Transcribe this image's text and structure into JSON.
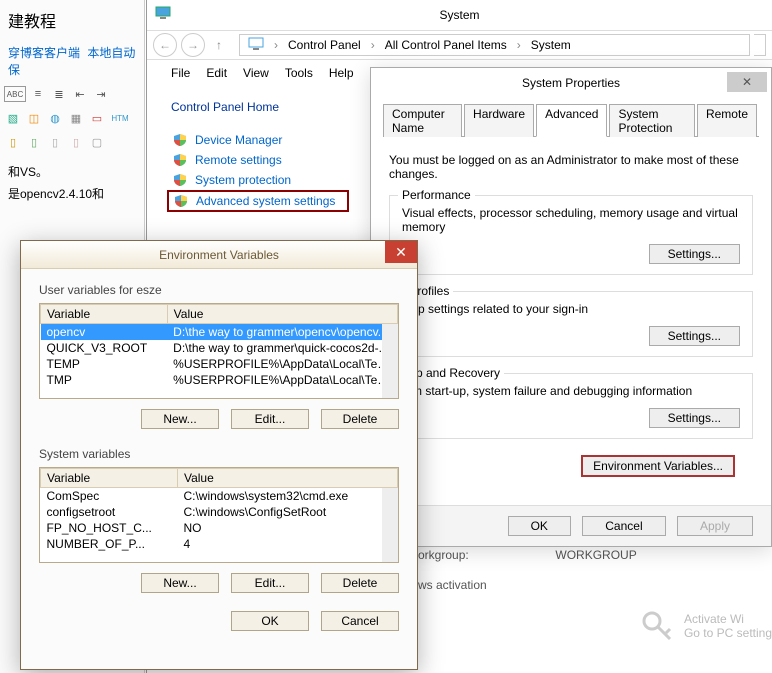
{
  "bg": {
    "title": "建教程",
    "links": [
      "穿博客客户端",
      "本地自动保"
    ],
    "text1": "和VS。",
    "text2": "是opencv2.4.10和"
  },
  "sys": {
    "title": "System",
    "crumb": [
      "Control Panel",
      "All Control Panel Items",
      "System"
    ],
    "menu": [
      "File",
      "Edit",
      "View",
      "Tools",
      "Help"
    ],
    "side_heading": "Control Panel Home",
    "links": [
      {
        "label": "Device Manager"
      },
      {
        "label": "Remote settings"
      },
      {
        "label": "System protection"
      },
      {
        "label": "Advanced system settings",
        "hl": true
      }
    ]
  },
  "prop": {
    "title": "System Properties",
    "tabs": [
      "Computer Name",
      "Hardware",
      "Advanced",
      "System Protection",
      "Remote"
    ],
    "note": "You must be logged on as an Administrator to make most of these changes.",
    "groups": [
      {
        "lbl": "Performance",
        "desc": "Visual effects, processor scheduling, memory usage and virtual memory",
        "btn": "Settings..."
      },
      {
        "lbl": "r Profiles",
        "desc": "ktop settings related to your sign-in",
        "btn": "Settings..."
      },
      {
        "lbl": "t-up and Recovery",
        "desc": "tem start-up, system failure and debugging information",
        "btn": "Settings..."
      }
    ],
    "env_btn": "Environment Variables...",
    "ok": "OK",
    "cancel": "Cancel",
    "apply": "Apply"
  },
  "frag": {
    "workgroup_lbl": "orkgroup:",
    "workgroup_val": "WORKGROUP",
    "activation": "ws activation",
    "activate": "Activate Wi",
    "activate_sub": "Go to PC setting"
  },
  "env": {
    "title": "Environment Variables",
    "user_lbl": "User variables for esze",
    "sys_lbl": "System variables",
    "col1": "Variable",
    "col2": "Value",
    "user_vars": [
      {
        "n": "opencv",
        "v": "D:\\the way to grammer\\opencv\\opencv...",
        "sel": true
      },
      {
        "n": "QUICK_V3_ROOT",
        "v": "D:\\the way to grammer\\quick-cocos2d-..."
      },
      {
        "n": "TEMP",
        "v": "%USERPROFILE%\\AppData\\Local\\Temp"
      },
      {
        "n": "TMP",
        "v": "%USERPROFILE%\\AppData\\Local\\Temp"
      }
    ],
    "sys_vars": [
      {
        "n": "ComSpec",
        "v": "C:\\windows\\system32\\cmd.exe"
      },
      {
        "n": "configsetroot",
        "v": "C:\\windows\\ConfigSetRoot"
      },
      {
        "n": "FP_NO_HOST_C...",
        "v": "NO"
      },
      {
        "n": "NUMBER_OF_P...",
        "v": "4"
      }
    ],
    "new": "New...",
    "edit": "Edit...",
    "del": "Delete",
    "ok": "OK",
    "cancel": "Cancel"
  }
}
